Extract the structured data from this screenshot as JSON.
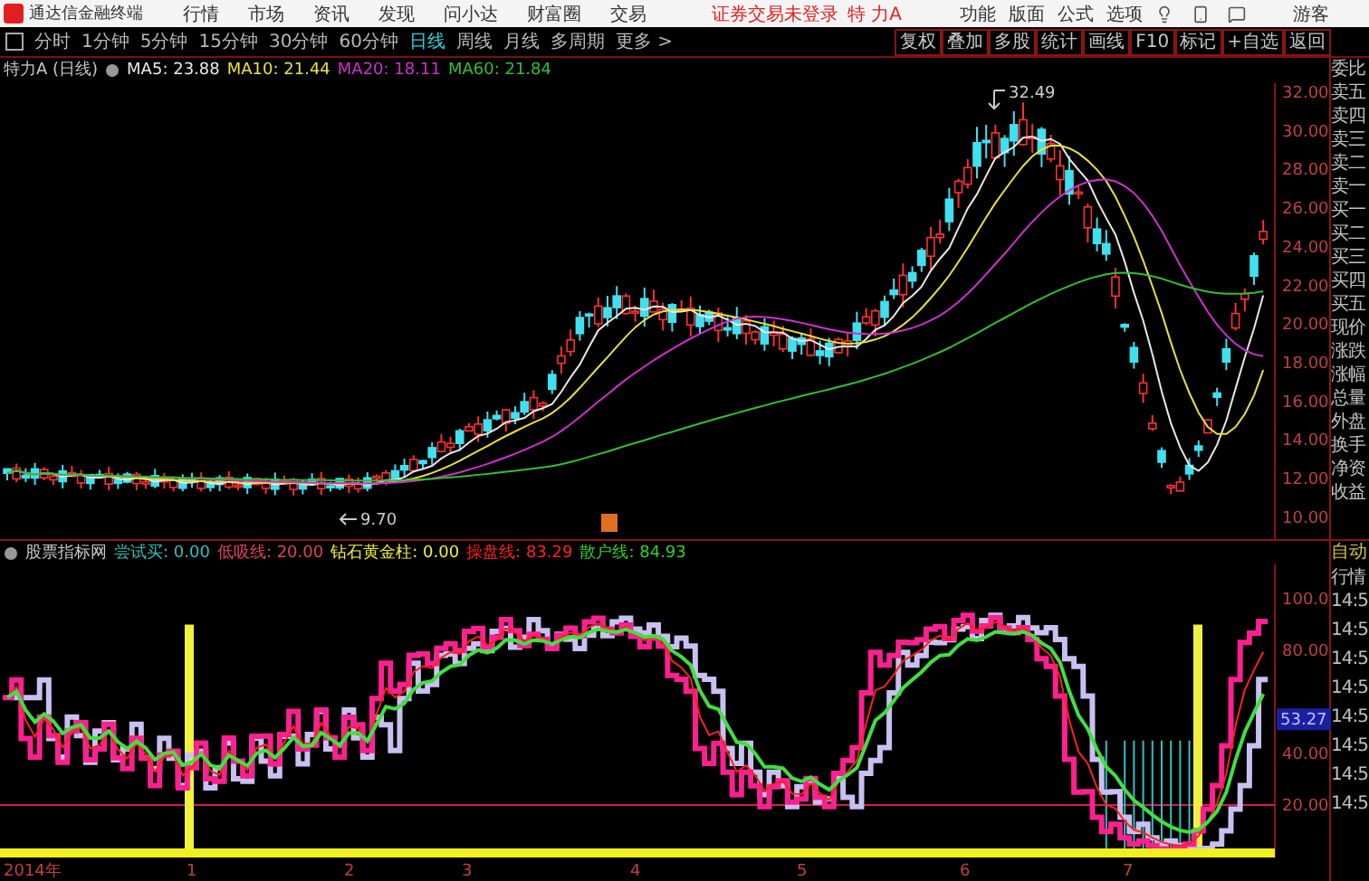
{
  "app_bar": {
    "title": "通达信金融终端",
    "menus": [
      "行情",
      "市场",
      "资讯",
      "发现",
      "问小达",
      "财富圈",
      "交易"
    ],
    "login_status": "证券交易未登录",
    "stock": "特 力A",
    "actions": [
      "功能",
      "版面",
      "公式",
      "选项"
    ],
    "user": "游客"
  },
  "period_tabs": [
    {
      "label": "分时",
      "selected": false
    },
    {
      "label": "1分钟",
      "selected": false
    },
    {
      "label": "5分钟",
      "selected": false
    },
    {
      "label": "15分钟",
      "selected": false
    },
    {
      "label": "30分钟",
      "selected": false
    },
    {
      "label": "60分钟",
      "selected": false
    },
    {
      "label": "日线",
      "selected": true
    },
    {
      "label": "周线",
      "selected": false
    },
    {
      "label": "月线",
      "selected": false
    },
    {
      "label": "多周期",
      "selected": false
    },
    {
      "label": "更多 >",
      "selected": false
    }
  ],
  "tool_buttons": [
    "复权",
    "叠加",
    "多股",
    "统计",
    "画线",
    "F10",
    "标记",
    "+自选",
    "返回"
  ],
  "price_chart": {
    "title": "特力A (日线)",
    "moving_averages": [
      {
        "label": "MA5: 23.88",
        "color": "#e8e8e8"
      },
      {
        "label": "MA10: 21.44",
        "color": "#e8e040"
      },
      {
        "label": "MA20: 18.11",
        "color": "#d030d0"
      },
      {
        "label": "MA60: 21.84",
        "color": "#30c030"
      }
    ],
    "axis_labels": [
      "32.00",
      "30.00",
      "28.00",
      "26.00",
      "24.00",
      "22.00",
      "20.00",
      "18.00",
      "16.00",
      "14.00",
      "12.00",
      "10.00"
    ],
    "high_label": "32.49",
    "low_label": "9.70"
  },
  "indicator": {
    "title": "股票指标网",
    "lines": [
      {
        "label": "尝试买: 0.00",
        "color": "#30c0c0"
      },
      {
        "label": "低吸线: 20.00",
        "color": "#e04060"
      },
      {
        "label": "钻石黄金柱: 0.00",
        "color": "#f0f040"
      },
      {
        "label": "操盘线: 83.29",
        "color": "#ff2020"
      },
      {
        "label": "散户线: 84.93",
        "color": "#30d030"
      }
    ],
    "axis_labels": [
      "100.0",
      "80.00",
      "40.00",
      "20.00"
    ],
    "current_value": "53.27"
  },
  "quote_panel": {
    "fields": [
      "委比",
      "卖五",
      "卖四",
      "卖三",
      "卖二",
      "卖一",
      "买一",
      "买二",
      "买三",
      "买四",
      "买五",
      "现价",
      "涨跌",
      "涨幅",
      "总量",
      "外盘",
      "换手",
      "净资",
      "收益"
    ],
    "auto_label": "自动",
    "market_label": "行情",
    "times": [
      "14:5",
      "14:5",
      "14:5",
      "14:5",
      "14:5",
      "14:5",
      "14:5",
      "14:5"
    ]
  },
  "time_axis": [
    "2014年",
    "1",
    "2",
    "3",
    "4",
    "5",
    "6",
    "7"
  ]
}
